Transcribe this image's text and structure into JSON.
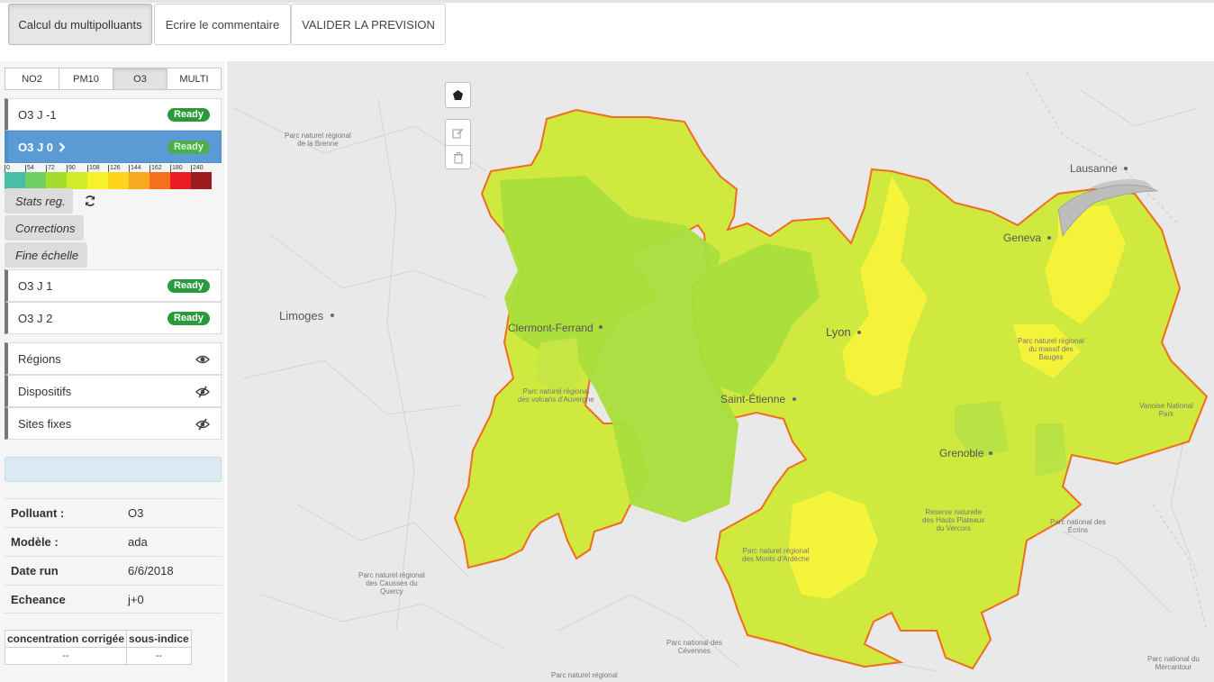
{
  "toolbar": {
    "calc_label": "Calcul du multipolluants",
    "comment_label": "Ecrire le commentaire",
    "validate_label": "VALIDER LA PREVISION"
  },
  "pollutant_tabs": [
    "NO2",
    "PM10",
    "O3",
    "MULTI"
  ],
  "pollutant_selected": "O3",
  "forecasts": {
    "j_minus_1": {
      "label": "O3 J -1",
      "status": "Ready"
    },
    "j0": {
      "label": "O3 J 0",
      "status": "Ready"
    },
    "j1": {
      "label": "O3 J 1",
      "status": "Ready"
    },
    "j2": {
      "label": "O3 J 2",
      "status": "Ready"
    }
  },
  "colorscale": {
    "ticks": [
      "0",
      "54",
      "72",
      "90",
      "108",
      "126",
      "144",
      "162",
      "180",
      "240"
    ],
    "colors": [
      "#47bfa6",
      "#6fcf63",
      "#a6dc2e",
      "#d2ea2c",
      "#f7f22c",
      "#fcd41f",
      "#f7aa21",
      "#f46f1e",
      "#ec1c24",
      "#9c1b1f"
    ]
  },
  "tools": {
    "stats_label": "Stats reg.",
    "corrections_label": "Corrections",
    "fine_label": "Fine échelle"
  },
  "layers": {
    "regions": "Régions",
    "dispositifs": "Dispositifs",
    "sites": "Sites fixes"
  },
  "properties": {
    "polluant_label": "Polluant :",
    "polluant_value": "O3",
    "modele_label": "Modèle :",
    "modele_value": "ada",
    "date_label": "Date run",
    "date_value": "6/6/2018",
    "echeance_label": "Echeance",
    "echeance_value": "j+0"
  },
  "conc_table": {
    "col1": "concentration corrigée",
    "col2": "sous-indice",
    "val1": "--",
    "val2": "--"
  },
  "map": {
    "cities": {
      "lausanne": "Lausanne",
      "geneva": "Geneva",
      "limoges": "Limoges",
      "clermont": "Clermont-Ferrand",
      "lyon": "Lyon",
      "saint_etienne": "Saint-Étienne",
      "grenoble": "Grenoble"
    },
    "parks": {
      "brenne": "Parc naturel régional\nde la Brenne",
      "volcans": "Parc naturel régional\ndes volcans d'Auvergne",
      "bauges": "Parc naturel régional\ndu massif des\nBauges",
      "vanoise": "Vanoise National\nPark",
      "vercors": "Reserve naturelle\ndes Hauts Plateaux\ndu Vercors",
      "ecrins": "Parc national des\nÉcrins",
      "ardeche": "Parc naturel régional\ndes Monts d'Ardèche",
      "causses": "Parc naturel régional\ndes Causses du\nQuercy",
      "cevennes": "Parc national des\nCévennes",
      "mercantour": "Parc national du\nMercantour",
      "bottom": "Parc naturel régional"
    },
    "region_fill": "#cfe93f",
    "region_border": "#f06c1e"
  }
}
